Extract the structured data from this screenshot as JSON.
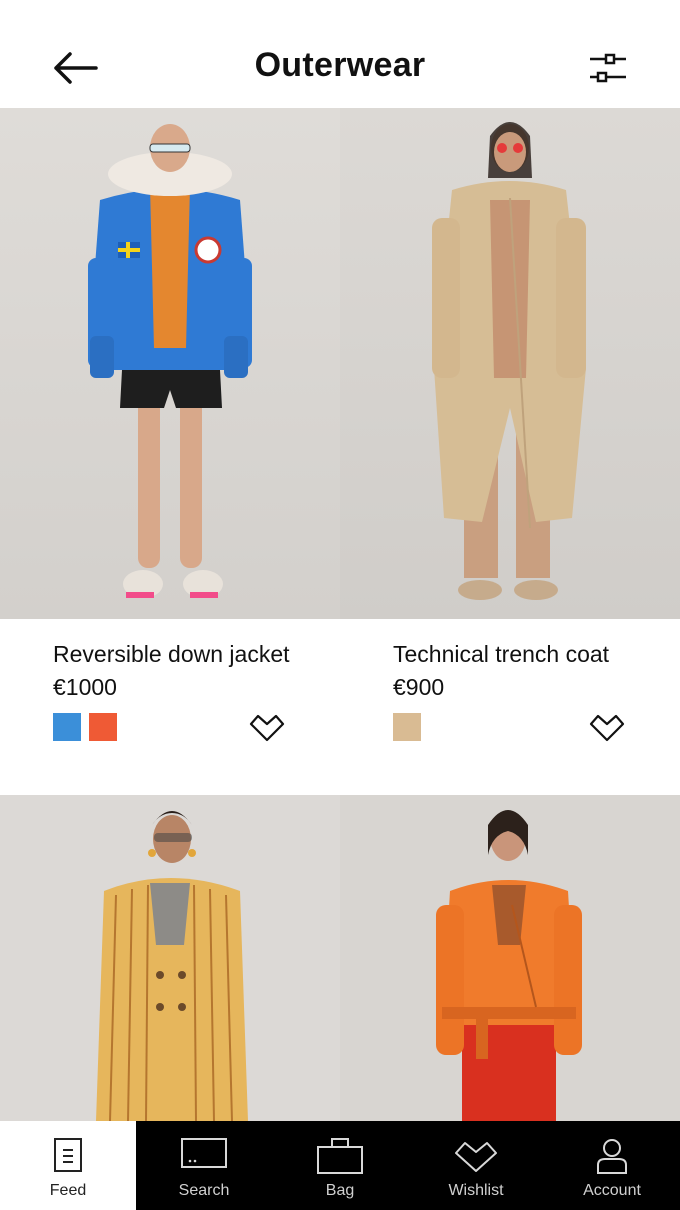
{
  "header": {
    "title": "Outerwear",
    "back_icon": "arrow-left-icon",
    "filter_icon": "sliders-icon"
  },
  "products": [
    {
      "name": "Reversible down jacket",
      "price": "€1000",
      "image": "model-blue-puffer-jacket",
      "swatches": [
        "#3b8fd9",
        "#ef5a35"
      ]
    },
    {
      "name": "Technical trench coat",
      "price": "€900",
      "image": "model-beige-trench-coat",
      "swatches": [
        "#d9bb93"
      ]
    },
    {
      "image": "model-yellow-striped-coat"
    },
    {
      "image": "model-orange-leather-jacket"
    }
  ],
  "nav": {
    "items": [
      {
        "label": "Feed",
        "icon": "feed-icon",
        "active": true
      },
      {
        "label": "Search",
        "icon": "search-icon",
        "active": false
      },
      {
        "label": "Bag",
        "icon": "bag-icon",
        "active": false
      },
      {
        "label": "Wishlist",
        "icon": "wishlist-icon",
        "active": false
      },
      {
        "label": "Account",
        "icon": "account-icon",
        "active": false
      }
    ]
  },
  "colors": {
    "nav_background": "#000000",
    "text": "#111111"
  }
}
